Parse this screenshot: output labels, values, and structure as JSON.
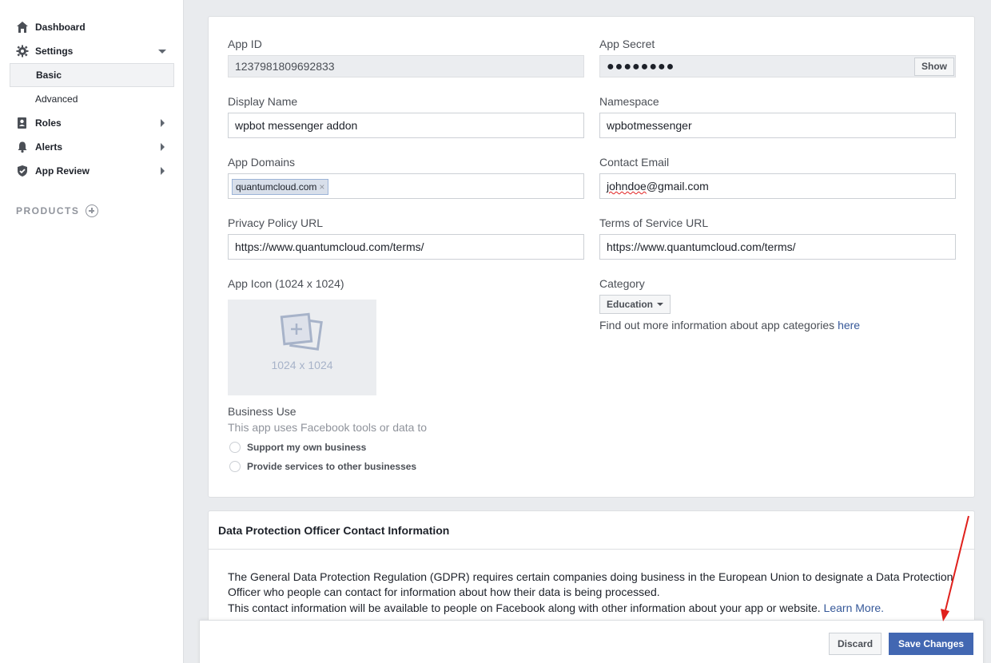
{
  "sidebar": {
    "items": [
      {
        "label": "Dashboard",
        "icon": "home-icon"
      },
      {
        "label": "Settings",
        "icon": "gear-icon"
      },
      {
        "label": "Basic"
      },
      {
        "label": "Advanced"
      },
      {
        "label": "Roles",
        "icon": "roles-icon"
      },
      {
        "label": "Alerts",
        "icon": "bell-icon"
      },
      {
        "label": "App Review",
        "icon": "shield-check-icon"
      }
    ],
    "products_label": "PRODUCTS"
  },
  "form": {
    "app_id_label": "App ID",
    "app_id_value": "1237981809692833",
    "app_secret_label": "App Secret",
    "app_secret_value": "●●●●●●●●",
    "show_label": "Show",
    "display_name_label": "Display Name",
    "display_name_value": "wpbot messenger addon",
    "namespace_label": "Namespace",
    "namespace_value": "wpbotmessenger",
    "app_domains_label": "App Domains",
    "app_domain_token": "quantumcloud.com",
    "contact_email_label": "Contact Email",
    "contact_email_user": "johndoe",
    "contact_email_domain": "@gmail.com",
    "privacy_url_label": "Privacy Policy URL",
    "privacy_url_value": "https://www.quantumcloud.com/terms/",
    "terms_url_label": "Terms of Service URL",
    "terms_url_value": "https://www.quantumcloud.com/terms/",
    "app_icon_label": "App Icon (1024 x 1024)",
    "app_icon_placeholder": "1024 x 1024",
    "category_label": "Category",
    "category_value": "Education",
    "category_info": "Find out more information about app categories ",
    "category_info_link": "here",
    "business_use_label": "Business Use",
    "business_use_sub": "This app uses Facebook tools or data to",
    "option_own": "Support my own business",
    "option_other": "Provide services to other businesses"
  },
  "dpo": {
    "title": "Data Protection Officer Contact Information",
    "text": "The General Data Protection Regulation (GDPR) requires certain companies doing business in the European Union to designate a Data Protection Officer who people can contact for information about how their data is being processed.",
    "text2": "This contact information will be available to people on Facebook along with other information about your app or website. ",
    "learn_more": "Learn More."
  },
  "footer": {
    "discard_label": "Discard",
    "save_label": "Save Changes"
  },
  "colors": {
    "primary": "#4267b2",
    "link": "#365899",
    "annotation_arrow": "#e0201c"
  }
}
